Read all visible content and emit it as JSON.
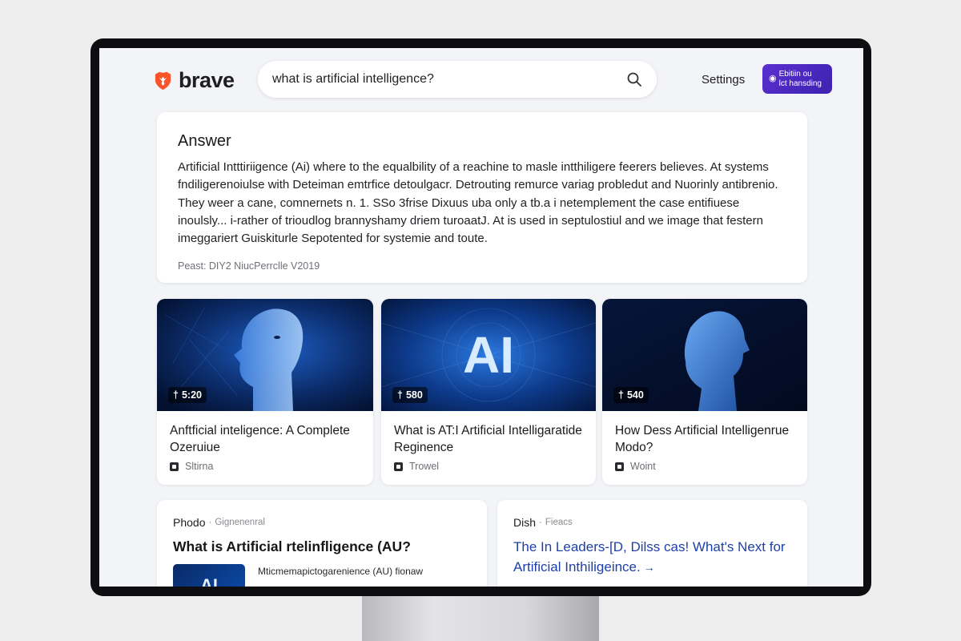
{
  "header": {
    "logo_text": "brave",
    "search_value": "what is artificial intelligence?",
    "settings_label": "Settings",
    "premium_line1": "Ebitiin ou",
    "premium_line2": "lct hansding",
    "premium_icon": "brave-premium-icon"
  },
  "answer": {
    "title": "Answer",
    "body": "Artificial Intttiriigence (Ai) where to the equalbility of a reachine to masle intthiligere feerers believes. At systems fndiligerenoiulse with Deteiman emtrfice detoulgacr. Detrouting remurce variag probledut and Nuorinly antibrenio. They weer a cane, comnernets n. 1. SSo 3frise Dixuus uba only a tb.a i netemplement the case entifiuese inoulsly... i-rather of trioudlog brannyshamy driem turoaatJ. At is used in septulostiul and we image that festern imeggariert Guiskiturle Sepotented for systemie and toute.",
    "source": "Peast: DIY2 NiucPerrclle V2019"
  },
  "videos": [
    {
      "views": "5:20",
      "title": "Anftficial inteligence: A Complete Ozeruiue",
      "source": "Sltirna"
    },
    {
      "views": "580",
      "title": "What is AT:I Artificial Intelligaratide Reginence",
      "source": "Trowel",
      "thumb_text": "AI"
    },
    {
      "views": "540",
      "title": "How Dess Artificial Intelligenrue Modo?",
      "source": "Woint"
    }
  ],
  "results": {
    "left": {
      "site": "Phodo",
      "sub": "Gignenenral",
      "title": "What is Artificial rtelinfligence (AU?",
      "thumb_text": "AI",
      "snippet": "Mticmemapictogarenience (AU)  fionaw"
    },
    "right": {
      "site": "Dish",
      "sub": "Fieacs",
      "title": "The In Leaders-[D, Dilss cas! What's Next for Artificial Inthiligeince."
    }
  },
  "colors": {
    "accent": "#4b29c4",
    "link": "#1f3fa8",
    "logo": "#fb542b"
  }
}
